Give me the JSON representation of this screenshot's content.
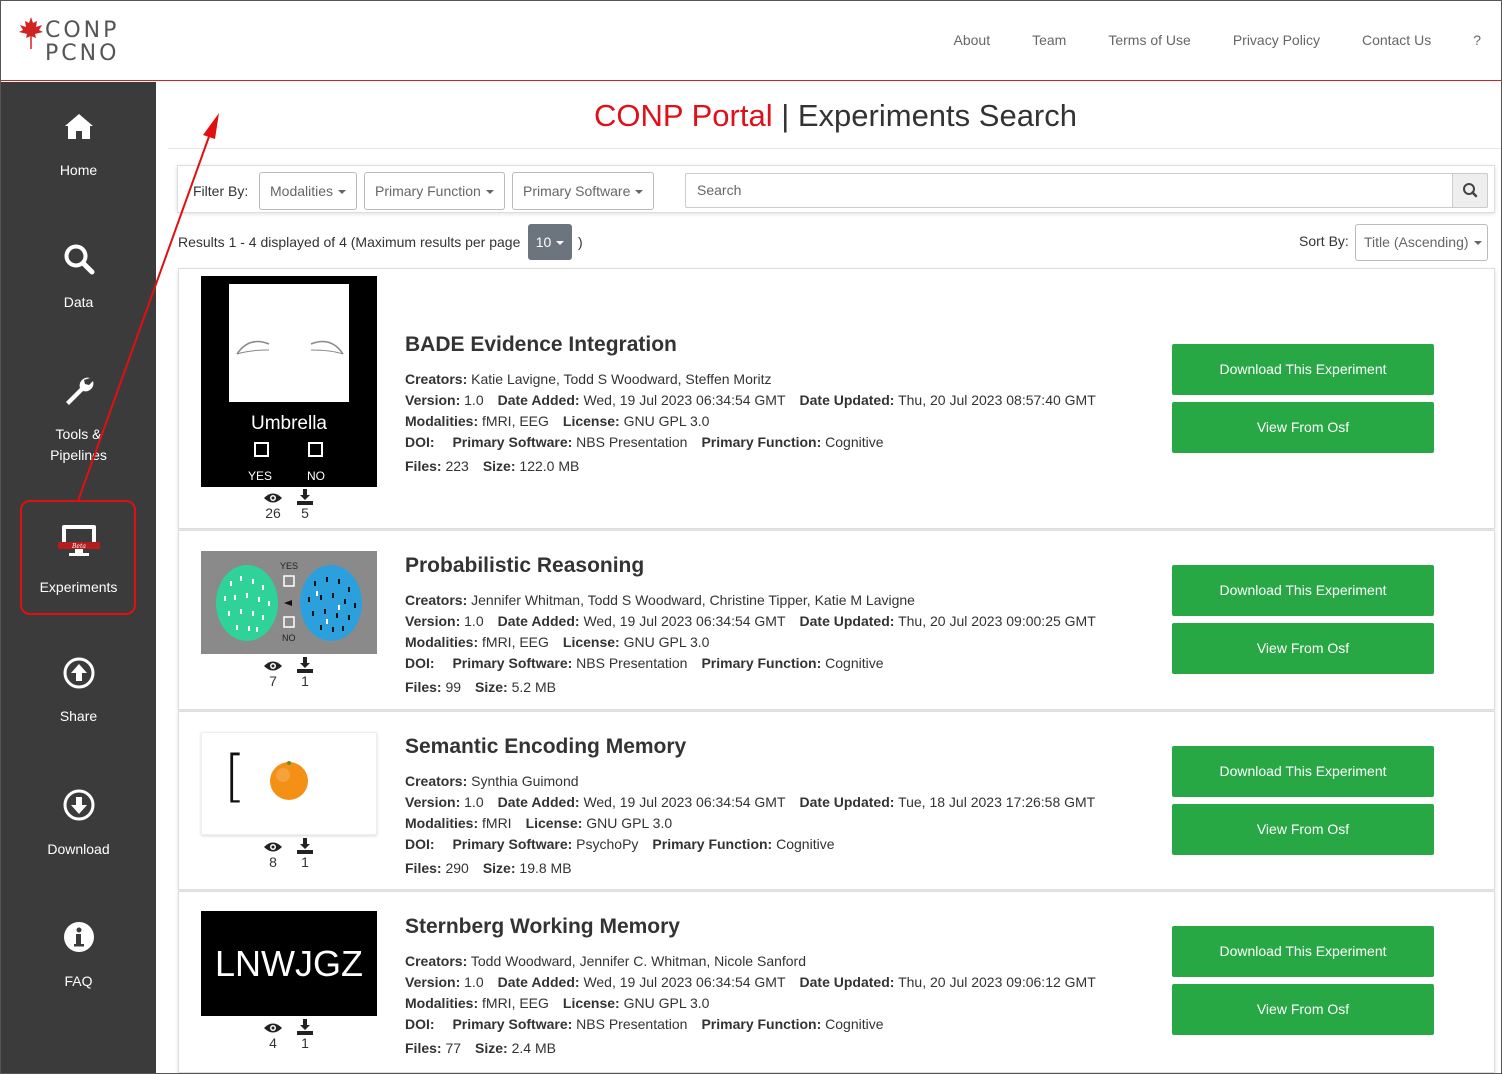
{
  "logo": {
    "line1": "CONP",
    "line2": "PCNO"
  },
  "topnav": [
    "About",
    "Team",
    "Terms of Use",
    "Privacy Policy",
    "Contact Us",
    "?"
  ],
  "sidebar": [
    {
      "label": "Home",
      "icon": "home-icon"
    },
    {
      "label": "Data",
      "icon": "search-icon"
    },
    {
      "label1": "Tools &",
      "label2": "Pipelines",
      "icon": "wrench-icon"
    },
    {
      "label": "Experiments",
      "icon": "monitor-beta-icon",
      "badge": "Beta"
    },
    {
      "label": "Share",
      "icon": "upload-circle-icon"
    },
    {
      "label": "Download",
      "icon": "download-circle-icon"
    },
    {
      "label": "FAQ",
      "icon": "info-circle-icon"
    }
  ],
  "title": {
    "brand": "CONP Portal",
    "sep": " | ",
    "rest": "Experiments Search"
  },
  "filter": {
    "label": "Filter By:",
    "modalities": "Modalities",
    "primary_function": "Primary Function",
    "primary_software": "Primary Software",
    "search_placeholder": "Search"
  },
  "results": {
    "text": "Results 1 - 4 displayed of 4 (Maximum results per page",
    "per_page": "10",
    "close": ")"
  },
  "sort": {
    "label": "Sort By:",
    "value": "Title (Ascending)"
  },
  "labels": {
    "creators": "Creators:",
    "version": "Version:",
    "date_added": "Date Added:",
    "date_updated": "Date Updated:",
    "modalities": "Modalities:",
    "license": "License:",
    "doi": "DOI:",
    "primary_software": "Primary Software:",
    "primary_function": "Primary Function:",
    "files": "Files:",
    "size": "Size:",
    "download_btn": "Download This Experiment",
    "osf_btn": "View From Osf"
  },
  "experiments": [
    {
      "title": "BADE Evidence Integration",
      "creators": "Katie Lavigne, Todd S Woodward, Steffen Moritz",
      "version": "1.0",
      "date_added": "Wed, 19 Jul 2023 06:34:54 GMT",
      "date_updated": "Thu, 20 Jul 2023 08:57:40 GMT",
      "modalities": "fMRI, EEG",
      "license": "GNU GPL 3.0",
      "doi": "",
      "primary_software": "NBS Presentation",
      "primary_function": "Cognitive",
      "files": "223",
      "size": "122.0 MB",
      "views": "26",
      "downloads": "5",
      "thumb": {
        "word": "Umbrella",
        "yes": "YES",
        "no": "NO"
      }
    },
    {
      "title": "Probabilistic Reasoning",
      "creators": "Jennifer Whitman, Todd S Woodward, Christine Tipper, Katie M Lavigne",
      "version": "1.0",
      "date_added": "Wed, 19 Jul 2023 06:34:54 GMT",
      "date_updated": "Thu, 20 Jul 2023 09:00:25 GMT",
      "modalities": "fMRI, EEG",
      "license": "GNU GPL 3.0",
      "doi": "",
      "primary_software": "NBS Presentation",
      "primary_function": "Cognitive",
      "files": "99",
      "size": "5.2 MB",
      "views": "7",
      "downloads": "1",
      "thumb": {
        "yes": "YES",
        "no": "NO"
      }
    },
    {
      "title": "Semantic Encoding Memory",
      "creators": "Synthia Guimond",
      "version": "1.0",
      "date_added": "Wed, 19 Jul 2023 06:34:54 GMT",
      "date_updated": "Tue, 18 Jul 2023 17:26:58 GMT",
      "modalities": "fMRI",
      "license": "GNU GPL 3.0",
      "doi": "",
      "primary_software": "PsychoPy",
      "primary_function": "Cognitive",
      "files": "290",
      "size": "19.8 MB",
      "views": "8",
      "downloads": "1",
      "thumb": {
        "bracket": "["
      }
    },
    {
      "title": "Sternberg Working Memory",
      "creators": "Todd Woodward, Jennifer C. Whitman, Nicole Sanford",
      "version": "1.0",
      "date_added": "Wed, 19 Jul 2023 06:34:54 GMT",
      "date_updated": "Thu, 20 Jul 2023 09:06:12 GMT",
      "modalities": "fMRI, EEG",
      "license": "GNU GPL 3.0",
      "doi": "",
      "primary_software": "NBS Presentation",
      "primary_function": "Cognitive",
      "files": "77",
      "size": "2.4 MB",
      "views": "4",
      "downloads": "1",
      "thumb": {
        "word": "LNWJGZ"
      }
    }
  ],
  "colors": {
    "brand_red": "#e0101a",
    "sidebar": "#3b3b3b",
    "button_green": "#27a844",
    "annotation_red": "#e01010"
  }
}
